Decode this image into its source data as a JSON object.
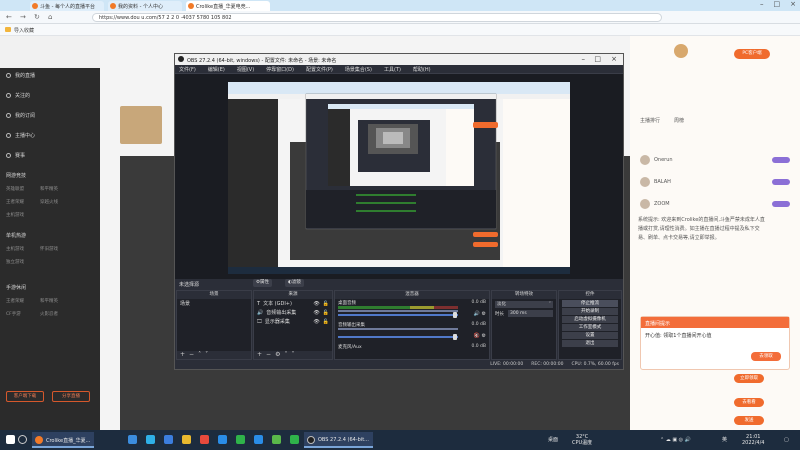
{
  "browser": {
    "tabs": [
      {
        "label": "斗鱼 - 每个人的直播平台",
        "color": "#f17a28"
      },
      {
        "label": "我的资料 - 个人中心",
        "color": "#f17a28"
      },
      {
        "label": "Crolike直播_华夏电竞...",
        "color": "#f17a28"
      }
    ],
    "url": "https://www.dou u.com/57 2 2 0 ·4037 5780 105 802",
    "bookmark": "导入收藏"
  },
  "site": {
    "sidebar": {
      "items": [
        "我的直播",
        "关注的",
        "我的订阅",
        "主播中心",
        "赛事"
      ],
      "section1": [
        "网游竞技",
        "英雄联盟",
        "和平精英",
        "王者荣耀",
        "穿越火线",
        "主机游戏"
      ],
      "section2": [
        "单机热游",
        "主机游戏",
        "怀旧游戏",
        "独立游戏"
      ],
      "section3": [
        "手游休闲",
        "王者荣耀",
        "和平精英",
        "CF手游",
        "火影忍者"
      ],
      "bottom_btns": [
        "客户端下载",
        "分享直播"
      ]
    },
    "right": {
      "pc_btn": "PC客户端",
      "rank_rows": [
        "主播排行",
        "周榜",
        "Onerun",
        "BALAH",
        "ZOOM"
      ],
      "chat": "系统提示: 欢迎来到Crolike的直播间,斗鱼严禁未成年人直播或打赏,请理性消费。如主播在直播过程中提及私下交易、刷单、点卡交易等,请立即举报。",
      "popup_title": "直播间提示",
      "popup_text": "开心值: 领取1个直播间开心值",
      "popup_btn": "去领取",
      "btn1": "立即领取",
      "btn2": "去看看",
      "btn3": "发送"
    }
  },
  "obs": {
    "title": "OBS 27.2.4 (64-bit, windows) - 配置文件: 未命名 - 场景: 未命名",
    "menu": [
      "文件(F)",
      "编辑(E)",
      "视图(V)",
      "停靠窗口(D)",
      "配置文件(P)",
      "场景集合(S)",
      "工具(T)",
      "帮助(H)"
    ],
    "toolbar_label": "未选择源",
    "props_btn": "属性",
    "filters_btn": "滤镜",
    "docks": {
      "scenes": {
        "title": "场景",
        "items": [
          "场景"
        ]
      },
      "sources": {
        "title": "来源",
        "items": [
          "文本 (GDI+)",
          "音频输出采集",
          "显示器采集"
        ]
      },
      "mixer": {
        "title": "混音器",
        "channels": [
          {
            "name": "桌面音频",
            "db": "0.0 dB"
          },
          {
            "name": "音频输出采集",
            "db": "0.0 dB"
          },
          {
            "name": "麦克风/Aux",
            "db": "0.0 dB"
          }
        ]
      },
      "transitions": {
        "title": "转场特效",
        "type": "淡化",
        "duration_label": "时长",
        "duration": "300 ms"
      },
      "controls": {
        "title": "控件",
        "buttons": [
          "停止推流",
          "开始录制",
          "启动虚拟摄像机",
          "工作室模式",
          "设置",
          "退出"
        ]
      }
    },
    "status": {
      "live": "LIVE: 00:00:00",
      "rec": "REC: 00:00:00",
      "cpu": "CPU: 0.7%, 60.00 fps"
    }
  },
  "taskbar": {
    "apps": [
      "Crolike直播_华夏...",
      "OBS 27.2.4 (64-bit..."
    ],
    "weather_temp": "32°C",
    "weather_text": "CPU温度",
    "ime": "英",
    "time": "21:01",
    "date": "2022/4/4"
  }
}
